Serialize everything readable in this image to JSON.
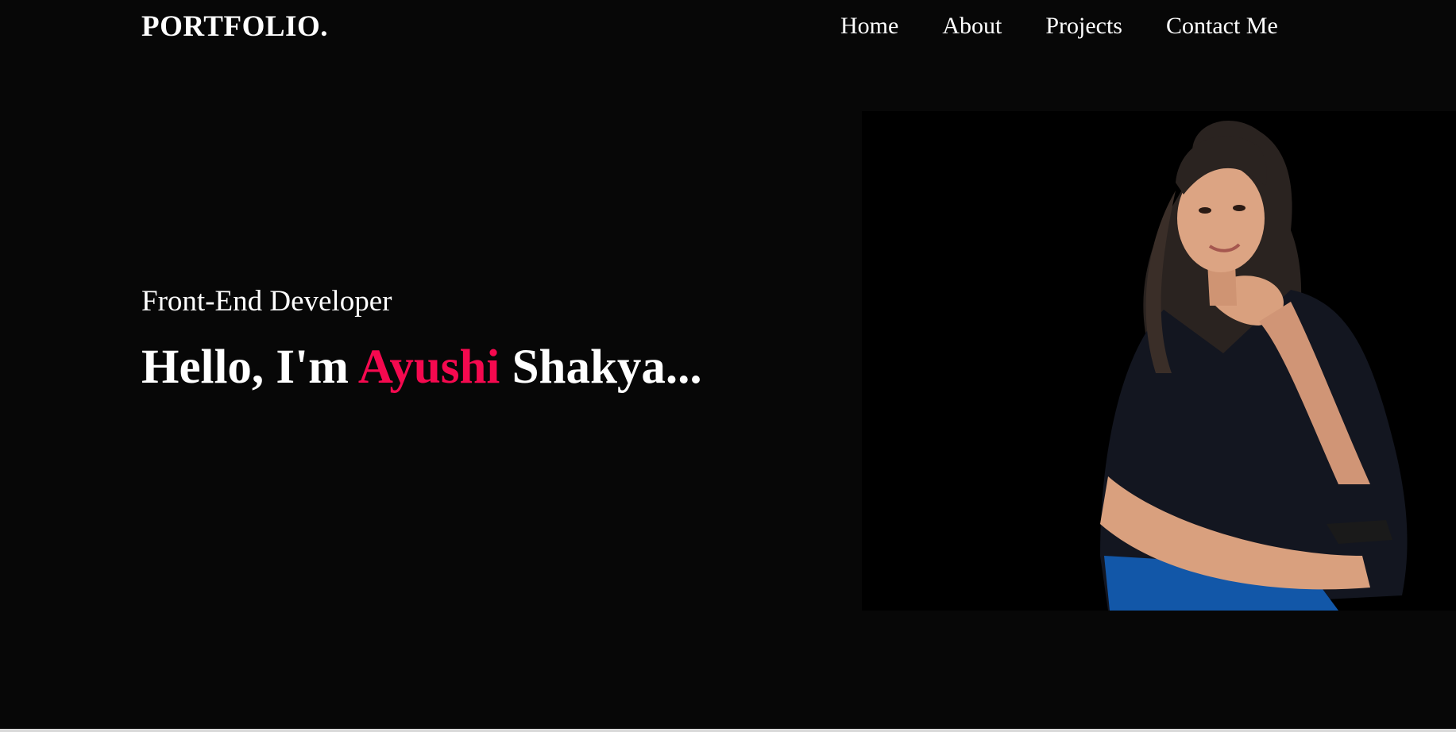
{
  "header": {
    "logo": "PORTFOLIO.",
    "nav": [
      "Home",
      "About",
      "Projects",
      "Contact Me"
    ]
  },
  "hero": {
    "subtitle": "Front-End Developer",
    "greeting_prefix": "Hello, I'm ",
    "first_name": "Ayushi",
    "last_name": " Shakya..."
  },
  "colors": {
    "background": "#070707",
    "accent": "#f5094f",
    "text": "#ffffff"
  },
  "icons": {
    "profile_photo": "portrait-photo"
  }
}
